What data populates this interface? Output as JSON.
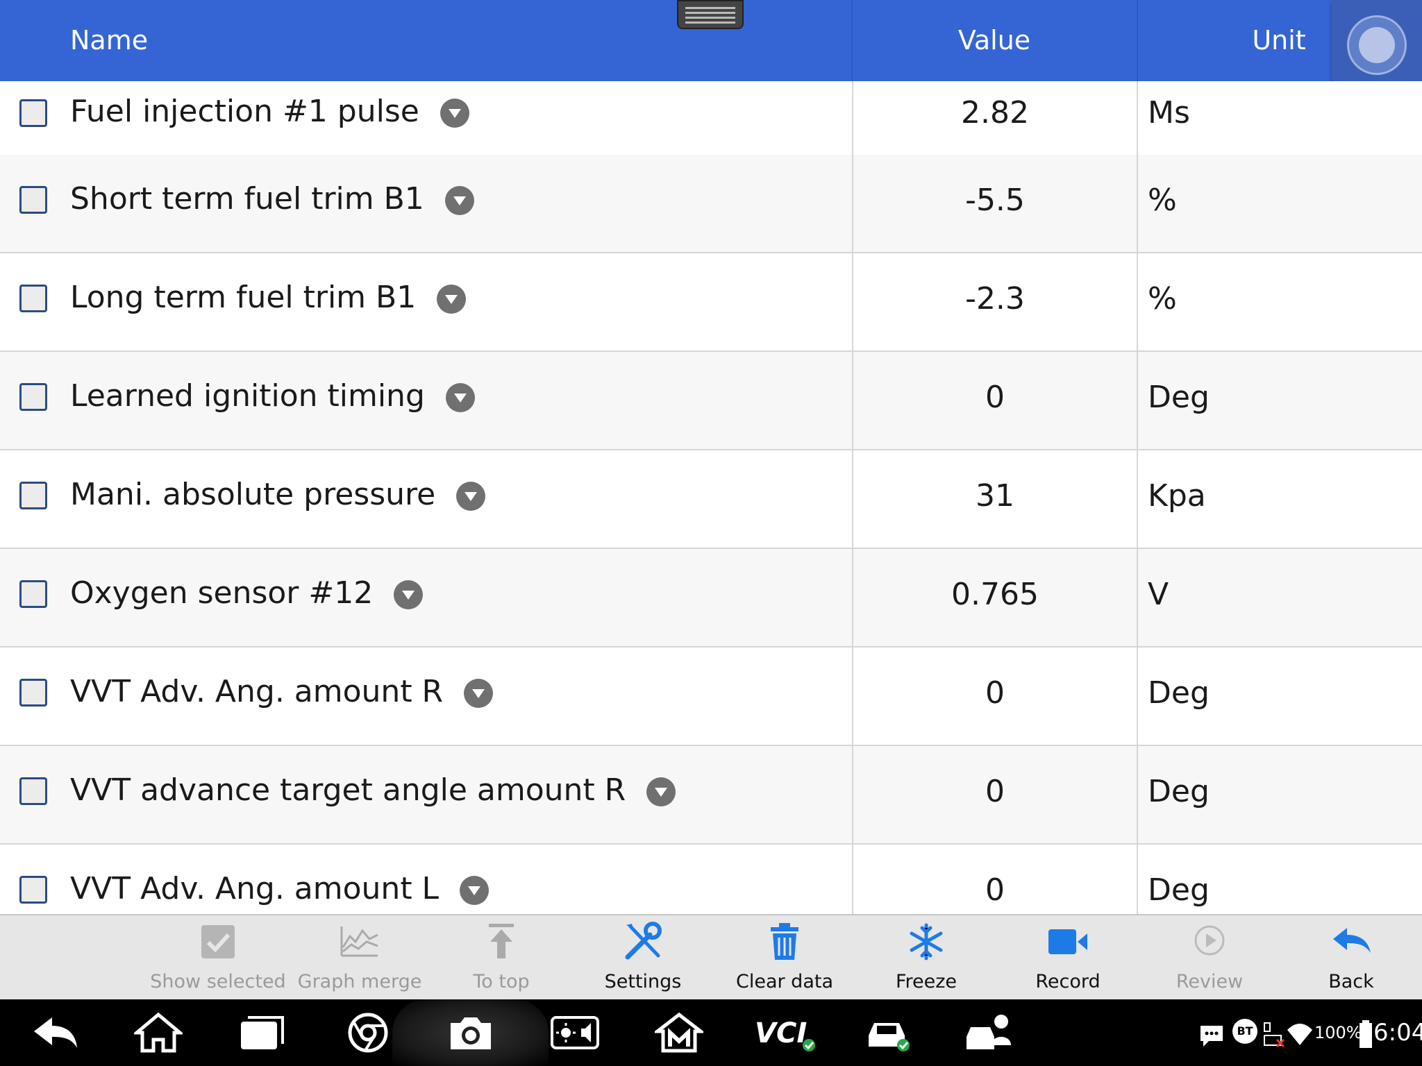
{
  "header": {
    "col_name": "Name",
    "col_value": "Value",
    "col_unit": "Unit"
  },
  "rows": [
    {
      "name": "Fuel injection #1 pulse",
      "value": "2.82",
      "unit": "Ms"
    },
    {
      "name": "Short term fuel trim B1",
      "value": "-5.5",
      "unit": "%"
    },
    {
      "name": "Long term fuel trim B1",
      "value": "-2.3",
      "unit": "%"
    },
    {
      "name": "Learned ignition timing",
      "value": "0",
      "unit": "Deg"
    },
    {
      "name": "Mani. absolute pressure",
      "value": "31",
      "unit": "Kpa"
    },
    {
      "name": "Oxygen sensor #12",
      "value": "0.765",
      "unit": "V"
    },
    {
      "name": "VVT Adv. Ang. amount R",
      "value": "0",
      "unit": "Deg"
    },
    {
      "name": "VVT advance target angle amount R",
      "value": "0",
      "unit": "Deg"
    },
    {
      "name": "VVT Adv. Ang. amount L",
      "value": "0",
      "unit": "Deg"
    }
  ],
  "toolbar": {
    "show_selected": "Show selected",
    "graph_merge": "Graph merge",
    "to_top": "To top",
    "settings": "Settings",
    "clear_data": "Clear data",
    "freeze": "Freeze",
    "record": "Record",
    "review": "Review",
    "back": "Back"
  },
  "status": {
    "battery": "100%",
    "time": "6:04",
    "bt": "BT"
  },
  "colors": {
    "header_bg": "#3565d4",
    "accent_blue": "#1e7be6",
    "toolbar_bg": "#e6e6e6"
  }
}
